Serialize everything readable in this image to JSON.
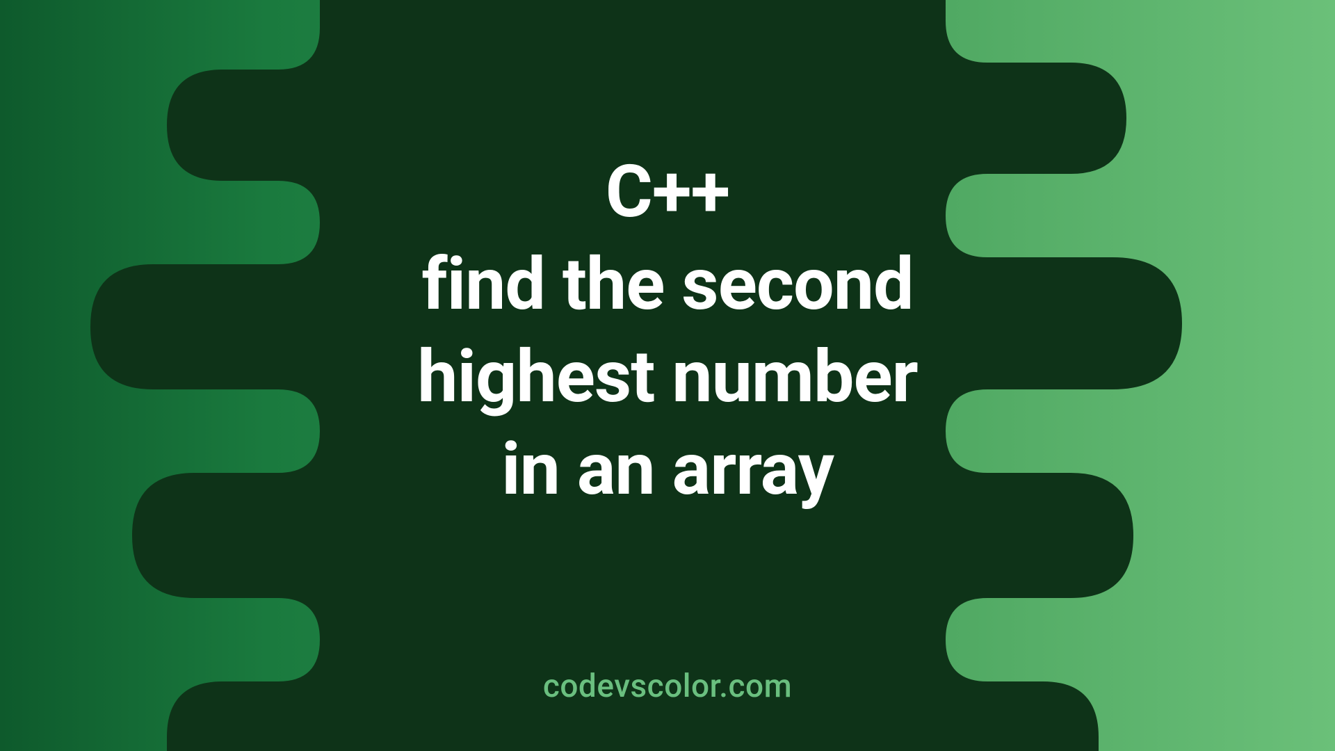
{
  "title": {
    "line1": "C++",
    "line2": "find the second",
    "line3": "highest number",
    "line4": "in an array"
  },
  "watermark": "codevscolor.com",
  "colors": {
    "blob": "#0e3318",
    "text": "#ffffff",
    "watermark": "#6abf7f",
    "gradient_start": "#0e5a2c",
    "gradient_end": "#6bc079"
  }
}
